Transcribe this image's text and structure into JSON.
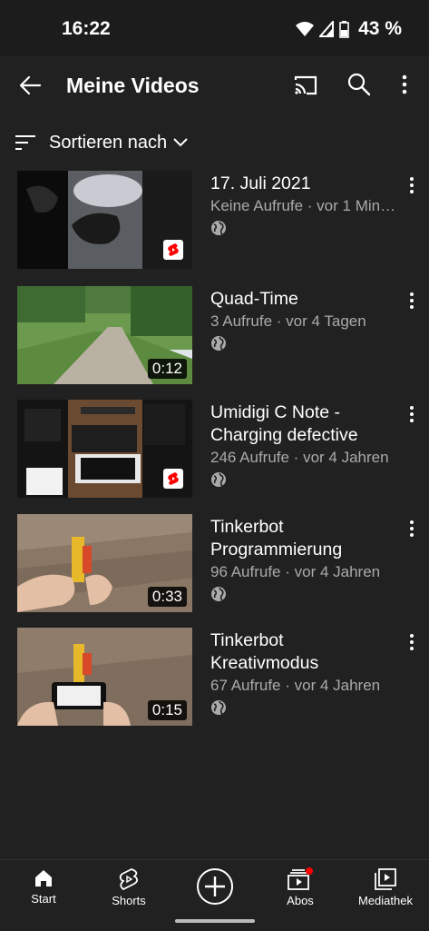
{
  "status_bar": {
    "time": "16:22",
    "battery": "43 %"
  },
  "app_bar": {
    "title": "Meine Videos",
    "icons": [
      "back-arrow-icon",
      "cast-icon",
      "search-icon",
      "more-vert-icon"
    ]
  },
  "sort": {
    "label": "Sortieren nach"
  },
  "videos": [
    {
      "title": "17. Juli 2021",
      "meta": "Keine Aufrufe · vor 1 Min…",
      "duration": "",
      "short": true,
      "visibility": "public"
    },
    {
      "title": "Quad-Time",
      "meta": "3 Aufrufe · vor 4 Tagen",
      "duration": "0:12",
      "short": false,
      "visibility": "public"
    },
    {
      "title": "Umidigi C Note - Charging defective",
      "meta": "246 Aufrufe · vor 4 Jahren",
      "duration": "",
      "short": true,
      "visibility": "public"
    },
    {
      "title": "Tinkerbot Programmierung",
      "meta": "96 Aufrufe · vor 4 Jahren",
      "duration": "0:33",
      "short": false,
      "visibility": "public"
    },
    {
      "title": "Tinkerbot Kreativmodus",
      "meta": "67 Aufrufe · vor 4 Jahren",
      "duration": "0:15",
      "short": false,
      "visibility": "public"
    }
  ],
  "bottom_nav": {
    "start": "Start",
    "shorts": "Shorts",
    "abos": "Abos",
    "mediathek": "Mediathek"
  },
  "colors": {
    "background": "#212121",
    "text_secondary": "#aaaaaa",
    "notification_dot": "#ff0000",
    "shorts_red": "#ff0000"
  }
}
